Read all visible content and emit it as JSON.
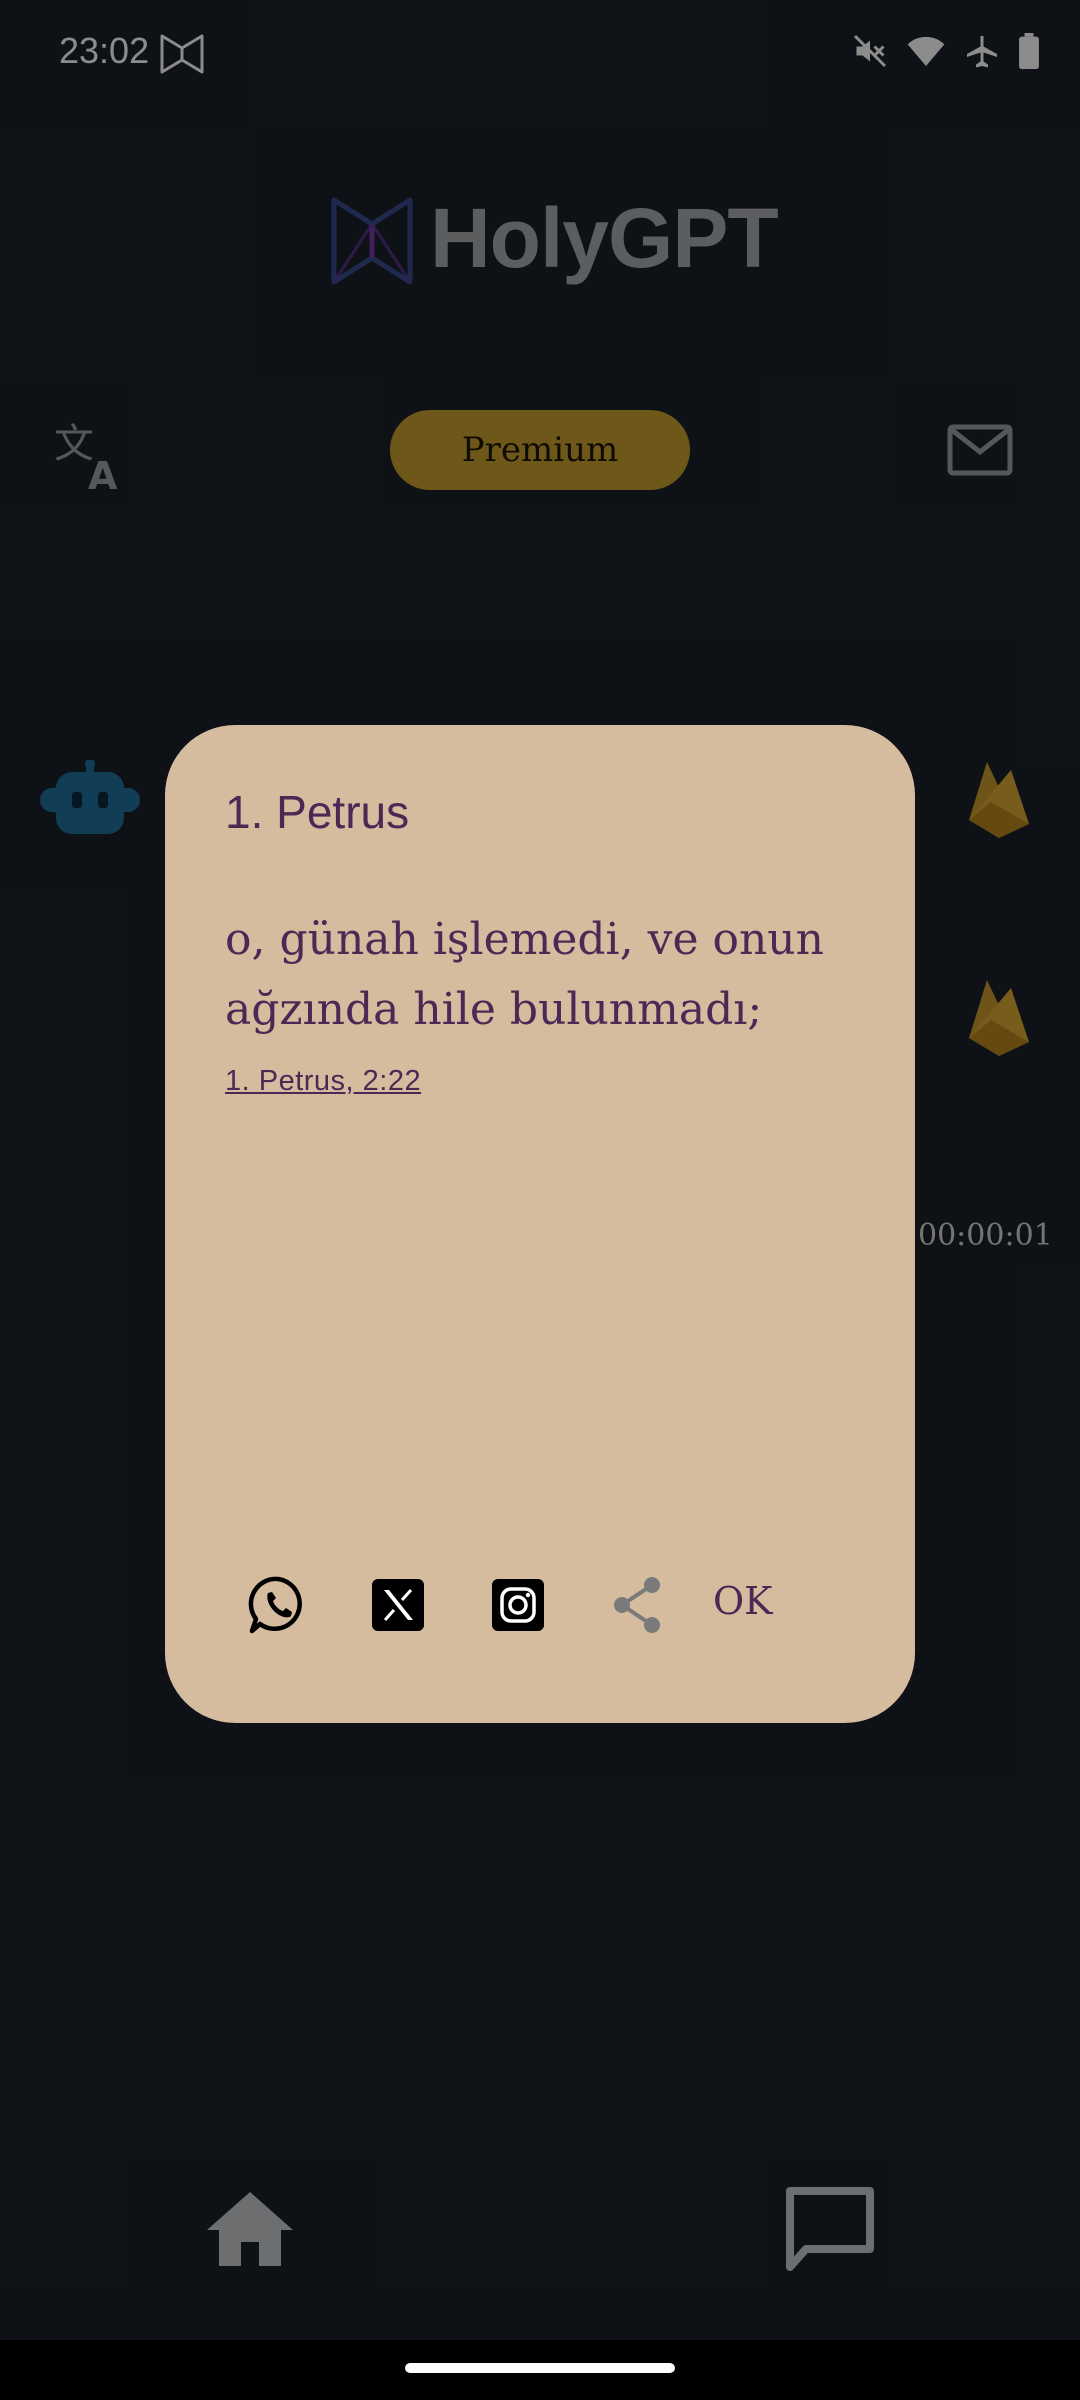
{
  "status_bar": {
    "time": "23:02",
    "icons": [
      "holygpt-app-icon",
      "mute-icon",
      "wifi-icon",
      "airplane-icon",
      "battery-icon"
    ]
  },
  "header": {
    "title": "HolyGPT",
    "logo": "holygpt-logo-icon"
  },
  "toolbar": {
    "translate_icon": "translate-icon",
    "premium_label": "Premium",
    "mail_icon": "mail-icon"
  },
  "content": {
    "robot_icon": "robot-icon",
    "flame_icons": [
      "firebase-icon",
      "firebase-icon"
    ],
    "timer": "00:00:01"
  },
  "dialog": {
    "title": "1. Petrus",
    "verse": "o, günah işlemedi, ve onun ağzında hile bulunmadı;",
    "reference": "1. Petrus, 2:22",
    "actions": {
      "icons": [
        "whatsapp-icon",
        "x-icon",
        "instagram-icon",
        "share-icon"
      ],
      "ok_label": "OK"
    }
  },
  "bottom_nav": {
    "items": [
      "home-icon",
      "chat-icon"
    ]
  },
  "colors": {
    "background": "#1b2029",
    "premium": "#c9a12e",
    "dialog_bg": "#d6bc9f",
    "dialog_text": "#4a2a55",
    "robot": "#1f6f9f",
    "flame": "#c99a2e"
  }
}
